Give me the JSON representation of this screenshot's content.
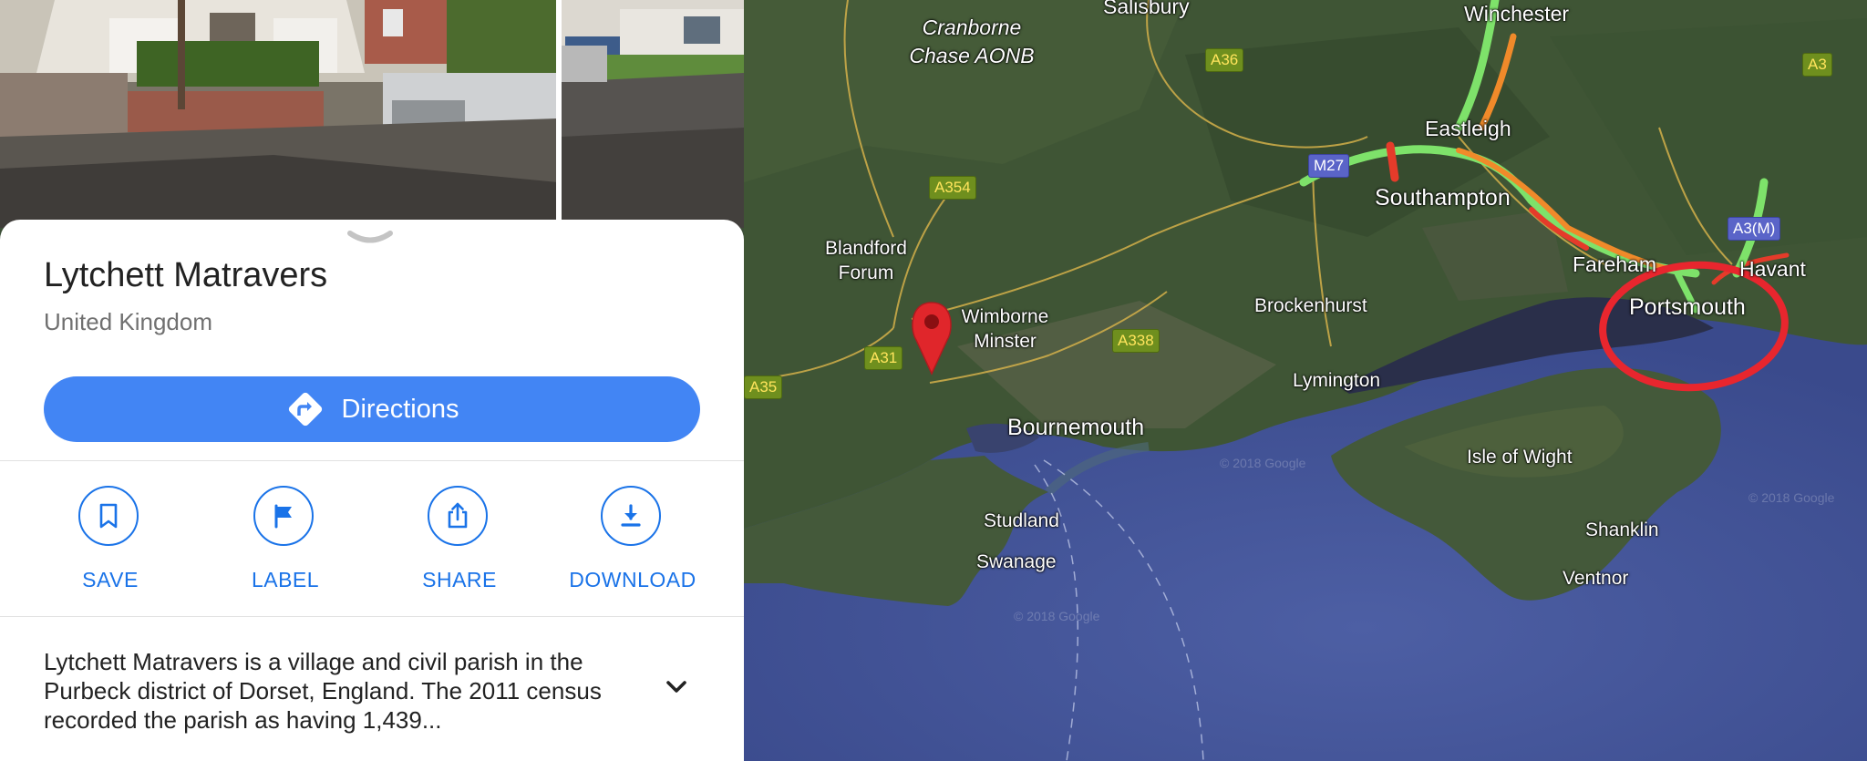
{
  "place": {
    "title": "Lytchett Matravers",
    "subtitle": "United Kingdom",
    "description": "Lytchett Matravers is a village and civil parish in the Purbeck district of Dorset, England. The 2011 census recorded the parish as having 1,439..."
  },
  "directions_label": "Directions",
  "actions": [
    {
      "label": "SAVE",
      "icon": "bookmark-icon"
    },
    {
      "label": "LABEL",
      "icon": "flag-icon"
    },
    {
      "label": "SHARE",
      "icon": "share-icon"
    },
    {
      "label": "DOWNLOAD",
      "icon": "download-icon"
    }
  ],
  "map": {
    "places": {
      "salisbury": "Salisbury",
      "winchester": "Winchester",
      "cranborne_line1": "Cranborne",
      "cranborne_line2": "Chase AONB",
      "eastleigh": "Eastleigh",
      "southampton": "Southampton",
      "blandford_line1": "Blandford",
      "blandford_line2": "Forum",
      "fareham": "Fareham",
      "havant": "Havant",
      "portsmouth": "Portsmouth",
      "brockenhurst": "Brockenhurst",
      "wimborne_line1": "Wimborne",
      "wimborne_line2": "Minster",
      "lymington": "Lymington",
      "bournemouth": "Bournemouth",
      "isle_of_wight": "Isle of Wight",
      "studland": "Studland",
      "shanklin": "Shanklin",
      "swanage": "Swanage",
      "ventnor": "Ventnor"
    },
    "roads": {
      "a36": "A36",
      "a3": "A3",
      "a354": "A354",
      "m27": "M27",
      "a3m": "A3(M)",
      "a31": "A31",
      "a338": "A338",
      "a35": "A35"
    },
    "watermark": "© 2018 Google",
    "highlight_color": "#e8262e",
    "pin_color": "#e0262b"
  }
}
